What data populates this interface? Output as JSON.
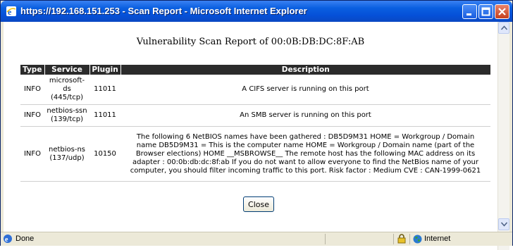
{
  "window": {
    "title": "https://192.168.151.253 - Scan Report - Microsoft Internet Explorer"
  },
  "report": {
    "title": "Vulnerability Scan Report of 00:0B:DB:DC:8F:AB",
    "columns": [
      "Type",
      "Service",
      "Plugin",
      "Description"
    ],
    "rows": [
      {
        "type": "INFO",
        "service": "microsoft-ds (445/tcp)",
        "plugin": "11011",
        "description": "A CIFS server is running on this port"
      },
      {
        "type": "INFO",
        "service": "netbios-ssn (139/tcp)",
        "plugin": "11011",
        "description": "An SMB server is running on this port"
      },
      {
        "type": "INFO",
        "service": "netbios-ns (137/udp)",
        "plugin": "10150",
        "description": "The following 6 NetBIOS names have been gathered : DB5D9M31 HOME = Workgroup / Domain name DB5D9M31 = This is the computer name HOME = Workgroup / Domain name (part of the Browser elections) HOME __MSBROWSE__ The remote host has the following MAC address on its adapter : 00:0b:db:dc:8f:ab If you do not want to allow everyone to find the NetBios name of your computer, you should filter incoming traffic to this port. Risk factor : Medium CVE : CAN-1999-0621"
      }
    ],
    "close_label": "Close"
  },
  "statusbar": {
    "status": "Done",
    "zone": "Internet"
  },
  "colors": {
    "titlebar": "#0a5fe0",
    "table_header": "#2b2b2b"
  },
  "icons": {
    "app": "ie-logo-icon",
    "status": "ie-page-icon",
    "security": "lock-icon",
    "zone": "globe-icon"
  }
}
